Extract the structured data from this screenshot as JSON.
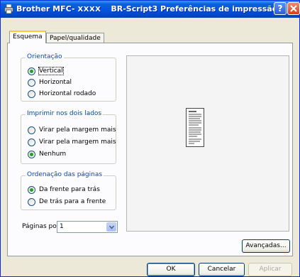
{
  "titlebar": {
    "brand": "Brother MFC-",
    "model": "XXXX",
    "title": "BR-Script3 Preferências de impressão",
    "help_label": "?"
  },
  "tabs": [
    {
      "label": "Esquema",
      "active": true
    },
    {
      "label": "Papel/qualidade",
      "active": false
    }
  ],
  "orientation": {
    "title": "Orientação",
    "options": [
      {
        "label": "Vertical",
        "checked": true
      },
      {
        "label": "Horizontal",
        "checked": false
      },
      {
        "label": "Horizontal rodado",
        "checked": false
      }
    ]
  },
  "duplex": {
    "title": "Imprimir nos dois lados",
    "options": [
      {
        "label": "Virar pela margem mais",
        "checked": false
      },
      {
        "label": "Virar pela margem mais",
        "checked": false
      },
      {
        "label": "Nenhum",
        "checked": true
      }
    ]
  },
  "page_order": {
    "title": "Ordenação das páginas",
    "options": [
      {
        "label": "Da frente para trás",
        "checked": true
      },
      {
        "label": "De trás para a frente",
        "checked": false
      }
    ]
  },
  "pages_per_sheet": {
    "label": "Páginas por folha:",
    "value": "1"
  },
  "buttons": {
    "advanced": "Avançadas...",
    "ok": "OK",
    "cancel": "Cancelar",
    "apply": "Aplicar"
  }
}
